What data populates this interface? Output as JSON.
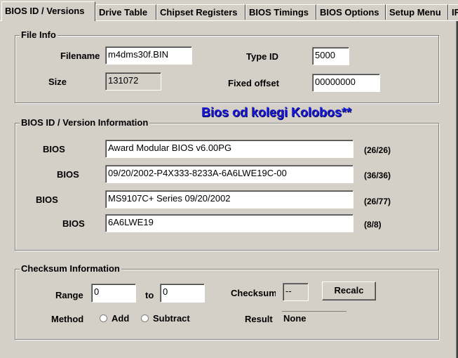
{
  "tabs": [
    "BIOS ID / Versions",
    "Drive Table",
    "Chipset Registers",
    "BIOS Timings",
    "BIOS Options",
    "Setup Menu",
    "IF"
  ],
  "file_info": {
    "title": "File Info",
    "filename_label": "Filename",
    "filename_value": "m4dms30f.BIN",
    "size_label": "Size",
    "size_value": "131072",
    "type_id_label": "Type ID",
    "type_id_value": "5000",
    "fixed_offset_label": "Fixed offset",
    "fixed_offset_value": "00000000"
  },
  "overlay_text": "Bios od kolegi Kolobos**",
  "bios_info": {
    "title": "BIOS ID / Version Information",
    "rows": [
      {
        "label": "BIOS",
        "value": "Award Modular BIOS v6.00PG",
        "count": "(26/26)"
      },
      {
        "label": "BIOS",
        "value": "09/20/2002-P4X333-8233A-6A6LWE19C-00",
        "count": "(36/36)"
      },
      {
        "label": "BIOS",
        "value": "MS9107C+ Series 09/20/2002",
        "count": "(26/77)"
      },
      {
        "label": "BIOS",
        "value": "6A6LWE19",
        "count": "(8/8)"
      }
    ]
  },
  "checksum": {
    "title": "Checksum Information",
    "range_label": "Range",
    "range_from": "0",
    "to_label": "to",
    "range_to": "0",
    "checksum_label": "Checksum",
    "checksum_value": "--",
    "recalc_label": "Recalc",
    "method_label": "Method",
    "add_label": "Add",
    "subtract_label": "Subtract",
    "result_label": "Result",
    "result_value": "None"
  }
}
